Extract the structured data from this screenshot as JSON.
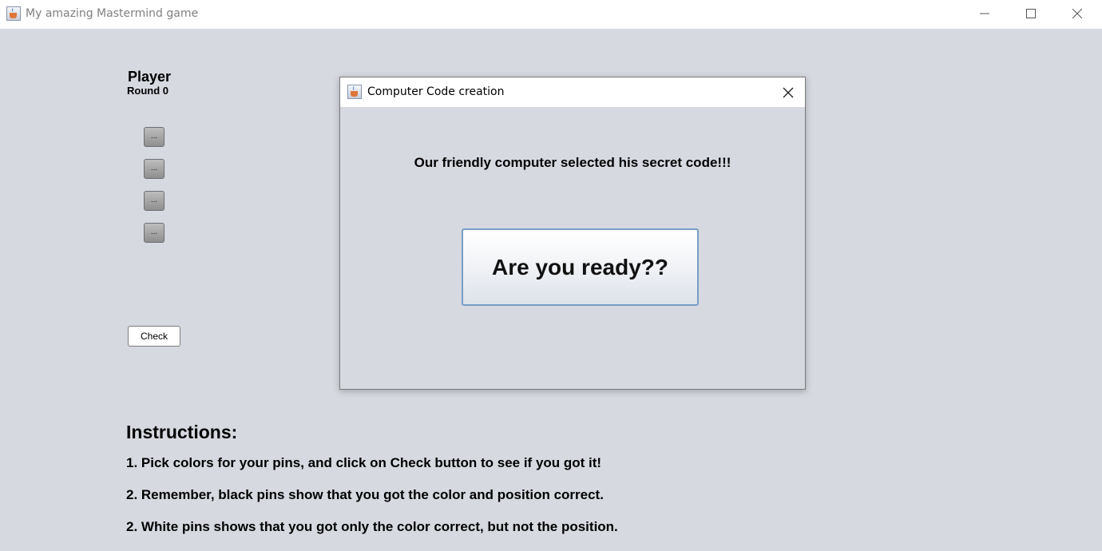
{
  "window": {
    "title": "My amazing Mastermind game",
    "icon": "java-app-icon",
    "controls": [
      "minimize-icon",
      "maximize-icon",
      "close-icon"
    ]
  },
  "player": {
    "name_label": "Player",
    "round_label": "Round 0"
  },
  "pins": [
    {
      "label": "..."
    },
    {
      "label": "..."
    },
    {
      "label": "..."
    },
    {
      "label": "..."
    }
  ],
  "check_button": {
    "label": "Check"
  },
  "instructions": {
    "title": "Instructions:",
    "lines": [
      "1. Pick colors for your pins, and click on Check button to see if you got it!",
      "2. Remember, black pins show that you got the color and position correct.",
      "2. White pins shows that you got only the color correct, but not the position."
    ]
  },
  "dialog": {
    "title": "Computer Code creation",
    "message": "Our friendly computer selected his secret code!!!",
    "button_label": "Are you ready??"
  },
  "colors": {
    "background": "#d6d9e0",
    "titlebar": "#ffffff",
    "button_border_accent": "#7a9cc8"
  }
}
